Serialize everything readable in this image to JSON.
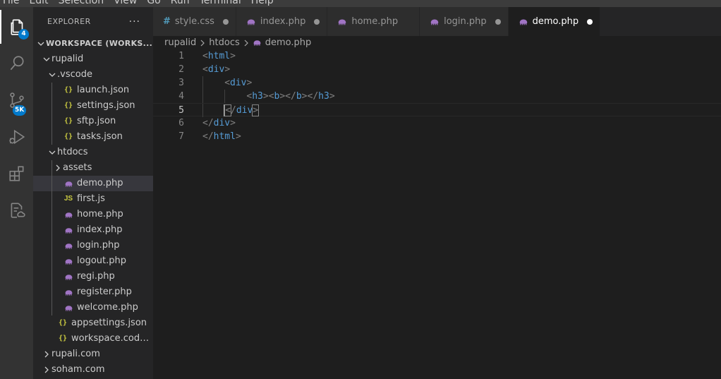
{
  "menu": [
    "File",
    "Edit",
    "Selection",
    "View",
    "Go",
    "Run",
    "Terminal",
    "Help"
  ],
  "activity": {
    "explorer_badge": "4",
    "scm_badge": "5K"
  },
  "sidebar": {
    "title": "EXPLORER",
    "more": "···",
    "workspace": "WORKSPACE (WORKS...",
    "tree": [
      {
        "label": "rupalid",
        "type": "folder-open",
        "depth": 1
      },
      {
        "label": ".vscode",
        "type": "folder-open",
        "depth": 2
      },
      {
        "label": "launch.json",
        "type": "json",
        "depth": 3
      },
      {
        "label": "settings.json",
        "type": "json",
        "depth": 3
      },
      {
        "label": "sftp.json",
        "type": "json",
        "depth": 3
      },
      {
        "label": "tasks.json",
        "type": "json",
        "depth": 3
      },
      {
        "label": "htdocs",
        "type": "folder-open",
        "depth": 2
      },
      {
        "label": "assets",
        "type": "folder-closed",
        "depth": 3
      },
      {
        "label": "demo.php",
        "type": "php",
        "depth": 3,
        "selected": true
      },
      {
        "label": "first.js",
        "type": "js",
        "depth": 3
      },
      {
        "label": "home.php",
        "type": "php",
        "depth": 3
      },
      {
        "label": "index.php",
        "type": "php",
        "depth": 3
      },
      {
        "label": "login.php",
        "type": "php",
        "depth": 3
      },
      {
        "label": "logout.php",
        "type": "php",
        "depth": 3
      },
      {
        "label": "regi.php",
        "type": "php",
        "depth": 3
      },
      {
        "label": "register.php",
        "type": "php",
        "depth": 3
      },
      {
        "label": "welcome.php",
        "type": "php",
        "depth": 3
      },
      {
        "label": "appsettings.json",
        "type": "json",
        "depth": 2
      },
      {
        "label": "workspace.code-...",
        "type": "json",
        "depth": 2
      },
      {
        "label": "rupali.com",
        "type": "folder-closed",
        "depth": 1
      },
      {
        "label": "soham.com",
        "type": "folder-closed",
        "depth": 1
      }
    ]
  },
  "tabs": [
    {
      "label": "style.css",
      "icon": "css",
      "modified": true,
      "active": false
    },
    {
      "label": "index.php",
      "icon": "php",
      "modified": true,
      "active": false
    },
    {
      "label": "home.php",
      "icon": "php",
      "modified": false,
      "active": false
    },
    {
      "label": "login.php",
      "icon": "php",
      "modified": true,
      "active": false
    },
    {
      "label": "demo.php",
      "icon": "php",
      "modified": true,
      "active": true
    }
  ],
  "breadcrumb": [
    "rupalid",
    "htdocs",
    "demo.php"
  ],
  "editor": {
    "lines": [
      {
        "n": "1",
        "tokens": [
          [
            "p",
            "<"
          ],
          [
            "t",
            "html"
          ],
          [
            "p",
            ">"
          ]
        ],
        "indent": 0
      },
      {
        "n": "2",
        "tokens": [
          [
            "p",
            "<"
          ],
          [
            "t",
            "div"
          ],
          [
            "p",
            ">"
          ]
        ],
        "indent": 0
      },
      {
        "n": "3",
        "tokens": [
          [
            "p",
            "<"
          ],
          [
            "t",
            "div"
          ],
          [
            "p",
            ">"
          ]
        ],
        "indent": 1
      },
      {
        "n": "4",
        "tokens": [
          [
            "p",
            "<"
          ],
          [
            "t",
            "h3"
          ],
          [
            "p",
            "><"
          ],
          [
            "t",
            "b"
          ],
          [
            "p",
            "></"
          ],
          [
            "t",
            "b"
          ],
          [
            "p",
            "></"
          ],
          [
            "t",
            "h3"
          ],
          [
            "p",
            ">"
          ]
        ],
        "indent": 2
      },
      {
        "n": "5",
        "tokens": [
          [
            "p",
            "</"
          ],
          [
            "t",
            "div"
          ],
          [
            "p",
            ">"
          ]
        ],
        "indent": 1,
        "current": true
      },
      {
        "n": "6",
        "tokens": [
          [
            "p",
            "</"
          ],
          [
            "t",
            "div"
          ],
          [
            "p",
            ">"
          ]
        ],
        "indent": 0
      },
      {
        "n": "7",
        "tokens": [
          [
            "p",
            "</"
          ],
          [
            "t",
            "html"
          ],
          [
            "p",
            ">"
          ]
        ],
        "indent": 0
      }
    ]
  },
  "colors": {
    "accent": "#007acc",
    "php_icon": "#a074c4",
    "json_icon": "#cbcb41",
    "css_icon": "#519aba",
    "tag": "#569cd6"
  }
}
